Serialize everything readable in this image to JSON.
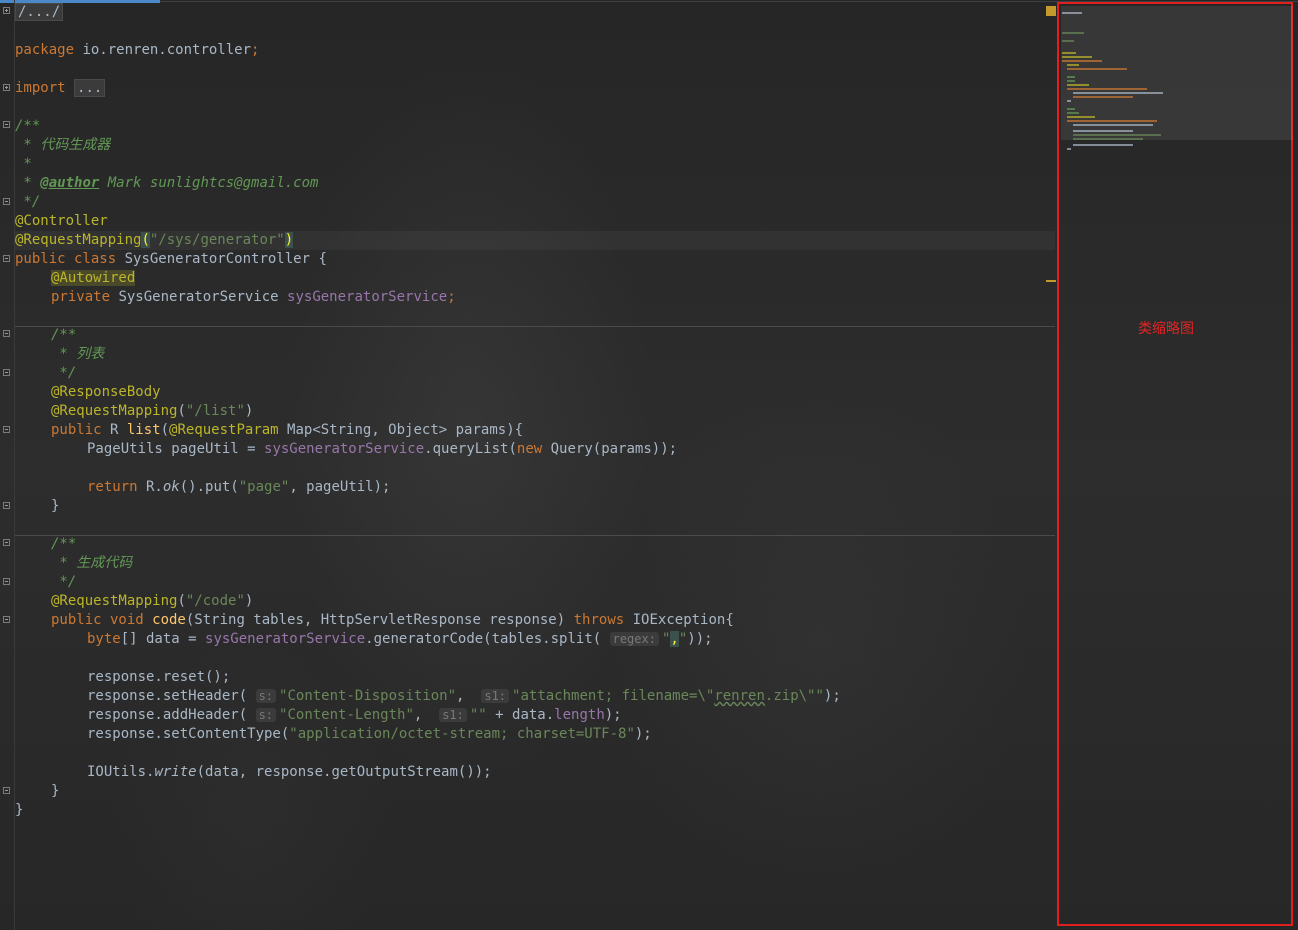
{
  "editor": {
    "lines": {
      "l1": "/.../",
      "l2_pkg_kw": "package",
      "l2_pkg_name": " io.renren.controller",
      "l2_semi": ";",
      "l3_import": "import",
      "l3_fold": "...",
      "l4": "/**",
      "l5": " * 代码生成器",
      "l6": " *",
      "l7_star": " * ",
      "l7_tag": "@author",
      "l7_rest": " Mark sunlightcs@gmail.com",
      "l8": " */",
      "l9": "@Controller",
      "l10_ann": "@RequestMapping",
      "l10_open": "(",
      "l10_str": "\"/sys/generator\"",
      "l10_close": ")",
      "l11_kw": "public class",
      "l11_name": " SysGeneratorController {",
      "l12": "@Autowired",
      "l13_kw": "private",
      "l13_type": " SysGeneratorService ",
      "l13_field": "sysGeneratorService",
      "l13_semi": ";",
      "l14": "/**",
      "l15": " * 列表",
      "l16": " */",
      "l17": "@ResponseBody",
      "l18_ann": "@RequestMapping",
      "l18_p1": "(",
      "l18_str": "\"/list\"",
      "l18_p2": ")",
      "l19_kw": "public",
      "l19_type": " R ",
      "l19_mth": "list",
      "l19_p": "(",
      "l19_ann": "@RequestParam",
      "l19_rest": " Map<String, Object> params",
      "l19_end": "){",
      "l20_a": "PageUtils pageUtil = ",
      "l20_field": "sysGeneratorService",
      "l20_b": ".queryList(",
      "l20_new": "new",
      "l20_c": " Query(params));",
      "l21_kw": "return",
      "l21_a": " R.",
      "l21_ok": "ok",
      "l21_b": "().put(",
      "l21_str": "\"page\"",
      "l21_c": ", pageUtil);",
      "l22": "}",
      "l23": "/**",
      "l24": " * 生成代码",
      "l25": " */",
      "l26_ann": "@RequestMapping",
      "l26_p1": "(",
      "l26_str": "\"/code\"",
      "l26_p2": ")",
      "l27_kw": "public void",
      "l27_mth": " code",
      "l27_a": "(String tables, HttpServletResponse response) ",
      "l27_throws": "throws",
      "l27_b": " IOException{",
      "l28_kw": "byte",
      "l28_a": "[] data = ",
      "l28_field": "sysGeneratorService",
      "l28_b": ".generatorCode(tables.split( ",
      "l28_hint": "regex:",
      "l28_str_q1": "\"",
      "l28_str_comma": ",",
      "l28_str_q2": "\"",
      "l28_c": "));",
      "l29": "response.reset();",
      "l30_a": "response.setHeader( ",
      "l30_hint1": "s:",
      "l30_str1": "\"Content-Disposition\"",
      "l30_comma": ",  ",
      "l30_hint2": "s1:",
      "l30_str2a": "\"attachment; filename=\\\"",
      "l30_str2b": "renren",
      "l30_str2c": ".zip\\\"\"",
      "l30_end": ");",
      "l31_a": "response.addHeader( ",
      "l31_hint1": "s:",
      "l31_str1": "\"Content-Length\"",
      "l31_comma": ",  ",
      "l31_hint2": "s1:",
      "l31_str2": "\"\"",
      "l31_b": " + data.",
      "l31_field": "length",
      "l31_end": ");",
      "l32_a": "response.setContentType(",
      "l32_str": "\"application/octet-stream; charset=UTF-8\"",
      "l32_end": ");",
      "l33_a": "IOUtils.",
      "l33_write": "write",
      "l33_b": "(data, response.getOutputStream());",
      "l34": "}",
      "l35": "}"
    }
  },
  "minimap": {
    "label": "类缩略图"
  },
  "colors": {
    "keyword": "#cc7832",
    "annotation": "#bbb529",
    "string": "#6a8759",
    "comment": "#629755",
    "field": "#9876aa",
    "method": "#ffc66d",
    "text": "#a9b7c6",
    "highlight_box": "#e21f1f"
  }
}
